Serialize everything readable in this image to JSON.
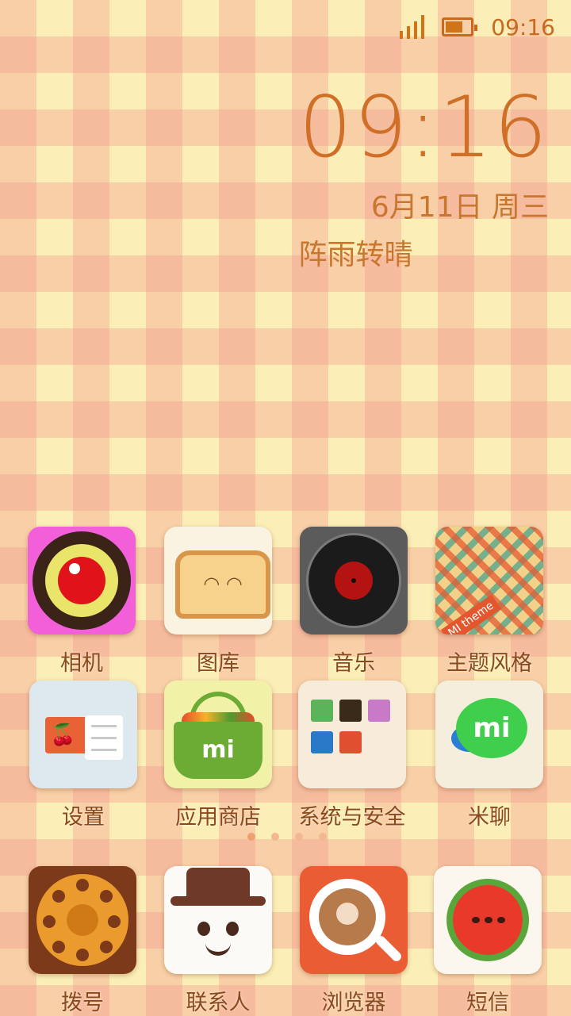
{
  "status_bar": {
    "time": "09:16",
    "signal_icon": "signal-icon",
    "battery_icon": "battery-icon",
    "battery_level": 0.6
  },
  "clock_widget": {
    "time": "09:16",
    "date": "6月11日 周三",
    "weather": "阵雨转晴"
  },
  "apps_row1": [
    {
      "label": "相机",
      "icon": "camera-icon"
    },
    {
      "label": "图库",
      "icon": "gallery-icon"
    },
    {
      "label": "音乐",
      "icon": "music-icon"
    },
    {
      "label": "主题风格",
      "icon": "theme-icon",
      "tag": "MI theme"
    }
  ],
  "apps_row2": [
    {
      "label": "设置",
      "icon": "settings-icon"
    },
    {
      "label": "应用商店",
      "icon": "app-store-icon",
      "badge": "mi"
    },
    {
      "label": "系统与安全",
      "icon": "system-security-icon"
    },
    {
      "label": "米聊",
      "icon": "mitalk-icon",
      "badge": "mi"
    }
  ],
  "page_indicator": {
    "pages": 4,
    "active": 0
  },
  "dock": [
    {
      "label": "拨号",
      "icon": "dialer-icon"
    },
    {
      "label": "联系人",
      "icon": "contacts-icon"
    },
    {
      "label": "浏览器",
      "icon": "browser-icon"
    },
    {
      "label": "短信",
      "icon": "messages-icon"
    }
  ],
  "colors": {
    "accent": "#d07028",
    "label": "#8a4a1c",
    "background": "#fbeeb6"
  }
}
